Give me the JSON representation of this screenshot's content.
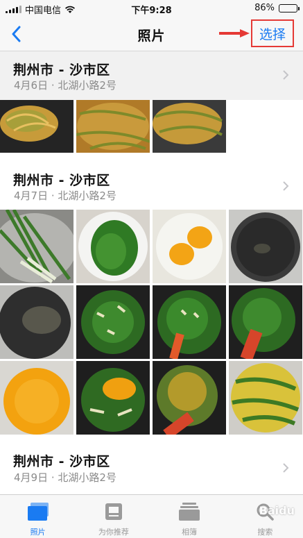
{
  "status_bar": {
    "carrier": "中国电信",
    "time": "下午9:28",
    "battery": "86%",
    "battery_level": 0.86
  },
  "nav": {
    "title": "照片",
    "back_icon": "chevron-left-icon",
    "select_label": "选择"
  },
  "sections": [
    {
      "title": "荆州市 - 沙市区",
      "date": "4月6日",
      "separator": " · ",
      "location": "北湖小路2号"
    },
    {
      "title": "荆州市 - 沙市区",
      "date": "4月7日",
      "separator": " · ",
      "location": "北湖小路2号"
    },
    {
      "title": "荆州市 - 沙市区",
      "date": "4月9日",
      "separator": " · ",
      "location": "北湖小路2号"
    }
  ],
  "tabs": [
    {
      "label": "照片",
      "icon": "photos-icon",
      "active": true
    },
    {
      "label": "为你推荐",
      "icon": "for-you-icon",
      "active": false
    },
    {
      "label": "相簿",
      "icon": "albums-icon",
      "active": false
    },
    {
      "label": "搜索",
      "icon": "search-icon",
      "active": false
    }
  ],
  "watermark": "Baidu",
  "colors": {
    "accent": "#1a7bf2",
    "highlight_box": "#e53935"
  }
}
